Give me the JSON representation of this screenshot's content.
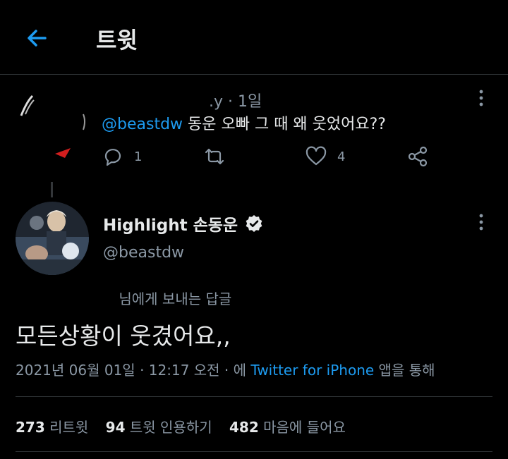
{
  "header": {
    "title": "트윗"
  },
  "parent_tweet": {
    "meta_visible": ".y · 1일",
    "mention": "@beastdw",
    "text": " 동운 오빠 그 때 왜 웃었어요??",
    "reply_count": "1",
    "like_count": "4"
  },
  "main_tweet": {
    "display_name": "Highlight 손동운",
    "handle": "@beastdw",
    "replying_to_suffix": "님에게 보내는 답글",
    "text": "모든상황이 웃겼어요,,",
    "timestamp": "2021년 06월 01일 · 12:17 오전 · 에 ",
    "source": "Twitter for iPhone",
    "source_suffix": " 앱을 통해",
    "stats": {
      "retweets": "273",
      "retweets_label": "리트윗",
      "quotes": "94",
      "quotes_label": "트윗 인용하기",
      "likes": "482",
      "likes_label": "마음에 들어요"
    }
  },
  "colors": {
    "accent": "#1d9bf0",
    "muted": "#8b98a5",
    "text": "#e7e9ea",
    "border": "#2f3336"
  }
}
